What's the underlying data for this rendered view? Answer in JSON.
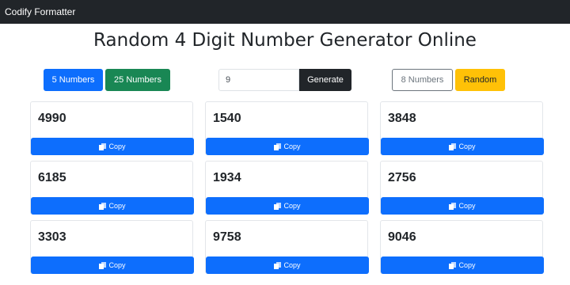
{
  "navbar": {
    "brand": "Codify Formatter"
  },
  "page": {
    "title": "Random 4 Digit Number Generator Online"
  },
  "controls": {
    "five_numbers_label": "5 Numbers",
    "twenty_five_numbers_label": "25 Numbers",
    "count_input_value": "9",
    "generate_label": "Generate",
    "eight_numbers_label": "8 Numbers",
    "random_label": "Random"
  },
  "copy_label": "Copy",
  "results": [
    {
      "number": "4990"
    },
    {
      "number": "1540"
    },
    {
      "number": "3848"
    },
    {
      "number": "6185"
    },
    {
      "number": "1934"
    },
    {
      "number": "2756"
    },
    {
      "number": "3303"
    },
    {
      "number": "9758"
    },
    {
      "number": "9046"
    }
  ],
  "colors": {
    "primary": "#0d6efd",
    "success": "#198754",
    "dark": "#212529",
    "warning": "#ffc107"
  }
}
